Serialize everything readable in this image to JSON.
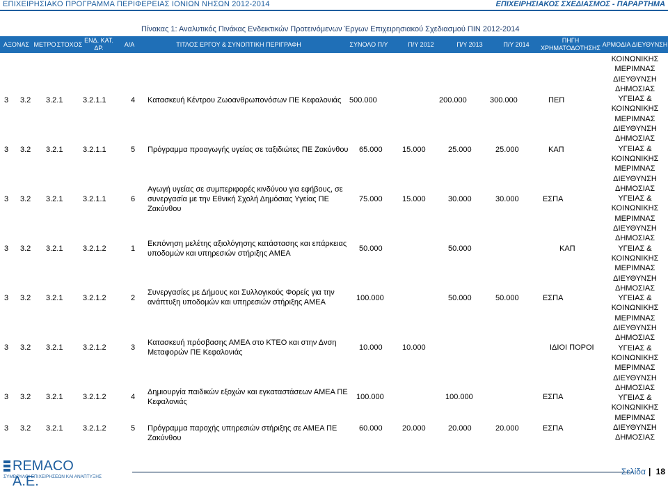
{
  "top": {
    "left": "ΕΠΙΧΕΙΡΗΣΙΑΚΟ ΠΡΟΓΡΑΜΜΑ ΠΕΡΙΦΕΡΕΙΑΣ ΙΟΝΙΩΝ ΝΗΣΩΝ 2012-2014",
    "right": "ΕΠΙΧΕΙΡΗΣΙΑΚΟΣ ΣΧΕΔΙΑΣΜΟΣ - ΠΑΡΑΡΤΗΜΑ"
  },
  "title": "Πίνακας 1: Αναλυτικός Πινάκας Ενδεικτικών Προτεινόμενων Έργων Επιχειρησιακού Σχεδιασμού ΠΙΝ 2012-2014",
  "headers": {
    "axonas": "ΑΞΟΝΑΣ",
    "metro": "ΜΕΤΡΟ",
    "stoxos": "ΣΤΟΧΟΣ",
    "end_kat": "ΕΝΔ. ΚΑΤ. ΔΡ.",
    "aa": "Α/Α",
    "titlos": "ΤΙΤΛΟΣ ΕΡΓΟΥ & ΣΥΝΟΠΤΙΚΗ ΠΕΡΙΓΡΑΦΗ",
    "synolo": "ΣΥΝΟΛΟ Π/Υ",
    "py2012": "Π/Υ 2012",
    "py2013": "Π/Υ 2013",
    "py2014": "Π/Υ 2014",
    "pigi": "ΠΗΓΗ ΧΡΗΜΑΤΟΔΟΤΗΣΗΣ",
    "armodia": "ΑΡΜΟΔΙΑ ΔΙΕΥΘΥΝΣΗ"
  },
  "rows": [
    {
      "axonas": "3",
      "metro": "3.2",
      "stoxos": "3.2.1",
      "end": "3.2.1.1",
      "aa": "4",
      "title": "Κατασκευή Κέντρου Ζωοανθρωπονόσων ΠΕ Κεφαλονιάς",
      "synolo": "500.000 ",
      "y2012": "",
      "y2013": "200.000 ",
      "y2014": "300.000 ",
      "pigi": "ΠΕΠ"
    },
    {
      "axonas": "3",
      "metro": "3.2",
      "stoxos": "3.2.1",
      "end": "3.2.1.1",
      "aa": "5",
      "title": "Πρόγραμμα προαγωγής υγείας σε ταξιδιώτες ΠΕ Ζακύνθου",
      "synolo": "65.000 ",
      "y2012": "15.000 ",
      "y2013": "25.000 ",
      "y2014": "25.000 ",
      "pigi": "ΚΑΠ"
    },
    {
      "axonas": "3",
      "metro": "3.2",
      "stoxos": "3.2.1",
      "end": "3.2.1.1",
      "aa": "6",
      "title": "Αγωγή υγείας σε συμπεριφορές κινδύνου για εφήβους, σε συνεργασία με την Εθνική Σχολή Δημόσιας Υγείας ΠΕ Ζακύνθου",
      "synolo": "75.000 ",
      "y2012": "15.000 ",
      "y2013": "30.000 ",
      "y2014": "30.000 ",
      "pigi": "ΕΣΠΑ"
    },
    {
      "axonas": "3",
      "metro": "3.2",
      "stoxos": "3.2.1",
      "end": "3.2.1.2",
      "aa": "1",
      "title": "Εκπόνηση μελέτης αξιολόγησης κατάστασης και επάρκειας υποδομών και υπηρεσιών στήριξης ΑΜΕΑ",
      "synolo": "50.000 ",
      "y2012": "",
      "y2013": "50.000 ",
      "y2014": "",
      "pigi": "ΚΑΠ"
    },
    {
      "axonas": "3",
      "metro": "3.2",
      "stoxos": "3.2.1",
      "end": "3.2.1.2",
      "aa": "2",
      "title": "Συνεργασίες με Δήμους και Συλλογικούς Φορείς για την ανάπτυξη υποδομών και υπηρεσιών στήριξης ΑΜΕΑ",
      "synolo": "100.000 ",
      "y2012": "",
      "y2013": "50.000 ",
      "y2014": "50.000 ",
      "pigi": "ΕΣΠΑ"
    },
    {
      "axonas": "3",
      "metro": "3.2",
      "stoxos": "3.2.1",
      "end": "3.2.1.2",
      "aa": "3",
      "title": "Κατασκευή πρόσβασης ΑΜΕΑ στο ΚΤΕΟ και στην Δνση Μεταφορών ΠΕ Κεφαλονιάς",
      "synolo": "10.000 ",
      "y2012": "10.000 ",
      "y2013": "",
      "y2014": "",
      "pigi": "ΙΔΙΟΙ ΠΟΡΟΙ"
    },
    {
      "axonas": "3",
      "metro": "3.2",
      "stoxos": "3.2.1",
      "end": "3.2.1.2",
      "aa": "4",
      "title": "Δημιουργία παιδικών εξοχών και εγκαταστάσεων ΑΜΕΑ ΠΕ Κεφαλονιάς",
      "synolo": "100.000 ",
      "y2012": "",
      "y2013": "100.000 ",
      "y2014": "",
      "pigi": "ΕΣΠΑ"
    },
    {
      "axonas": "3",
      "metro": "3.2",
      "stoxos": "3.2.1",
      "end": "3.2.1.2",
      "aa": "5",
      "title": "Πρόγραμμα παροχής υπηρεσιών στήριξης σε ΑΜΕΑ ΠΕ Ζακύνθου",
      "synolo": "60.000 ",
      "y2012": "20.000 ",
      "y2013": "20.000 ",
      "y2014": "20.000 ",
      "pigi": "ΕΣΠΑ"
    }
  ],
  "armodia_lines": [
    "ΚΟΙΝΩΝΙΚΗΣ",
    "ΜΕΡΙΜΝΑΣ",
    "ΔΙΕΥΘΥΝΣΗ",
    "ΔΗΜΟΣΙΑΣ",
    "ΥΓΕΙΑΣ &",
    "ΚΟΙΝΩΝΙΚΗΣ",
    "ΜΕΡΙΜΝΑΣ",
    "ΔΙΕΥΘΥΝΣΗ",
    "ΔΗΜΟΣΙΑΣ",
    "ΥΓΕΙΑΣ &",
    "ΚΟΙΝΩΝΙΚΗΣ",
    "ΜΕΡΙΜΝΑΣ",
    "ΔΙΕΥΘΥΝΣΗ",
    "ΔΗΜΟΣΙΑΣ",
    "ΥΓΕΙΑΣ &",
    "ΚΟΙΝΩΝΙΚΗΣ",
    "ΜΕΡΙΜΝΑΣ",
    "ΔΙΕΥΘΥΝΣΗ",
    "ΔΗΜΟΣΙΑΣ",
    "ΥΓΕΙΑΣ &",
    "ΚΟΙΝΩΝΙΚΗΣ",
    "ΜΕΡΙΜΝΑΣ",
    "ΔΙΕΥΘΥΝΣΗ",
    "ΔΗΜΟΣΙΑΣ",
    "ΥΓΕΙΑΣ &",
    "ΚΟΙΝΩΝΙΚΗΣ",
    "ΜΕΡΙΜΝΑΣ",
    "ΔΙΕΥΘΥΝΣΗ",
    "ΔΗΜΟΣΙΑΣ",
    "ΥΓΕΙΑΣ &",
    "ΚΟΙΝΩΝΙΚΗΣ",
    "ΜΕΡΙΜΝΑΣ",
    "ΔΙΕΥΘΥΝΣΗ",
    "ΔΗΜΟΣΙΑΣ",
    "ΥΓΕΙΑΣ &",
    "ΚΟΙΝΩΝΙΚΗΣ",
    "ΜΕΡΙΜΝΑΣ",
    "ΔΙΕΥΘΥΝΣΗ",
    "ΔΗΜΟΣΙΑΣ"
  ],
  "footer": {
    "logo_name": "REMACO A.E.",
    "logo_sub": "ΣΥΜΒΟΥΛΟΙ ΕΠΙΧΕΙΡΗΣΕΩΝ ΚΑΙ ΑΝΑΠΤΥΞΗΣ",
    "slide_label": "Σελίδα",
    "slide_num": "18"
  },
  "colors": {
    "accent": "#1f6fb7",
    "text_blue": "#1f5f9f"
  }
}
